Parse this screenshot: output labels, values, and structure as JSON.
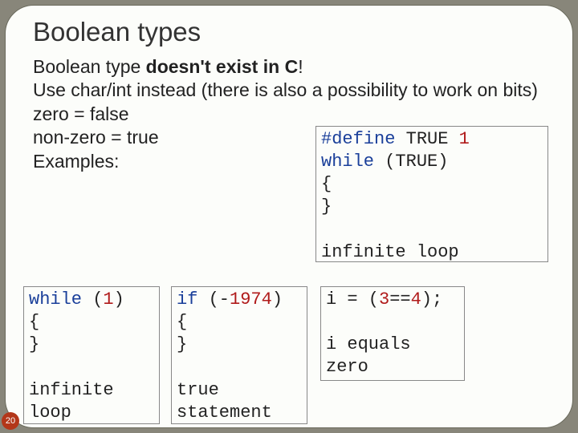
{
  "title": "Boolean types",
  "body": {
    "line1a": "Boolean type ",
    "line1b": "doesn't exist in C",
    "line1c": "!",
    "line2": "Use char/int instead (there is also a possibility to work on bits)",
    "line3": "zero = false",
    "line4": "non-zero = true",
    "line5": "Examples:"
  },
  "box1": {
    "l1a": "#define",
    "l1b": " TRUE ",
    "l1c": "1",
    "l2a": "while",
    "l2b": " (TRUE)",
    "l3": "{",
    "l4": "}",
    "l6": "infinite loop"
  },
  "box2": {
    "l1a": "while",
    "l1b": " (",
    "l1c": "1",
    "l1d": ")",
    "l2": "{",
    "l3": "}",
    "l5a": "infinite",
    "l5b": "loop"
  },
  "box3": {
    "l1a": "if",
    "l1b": " (-",
    "l1c": "1974",
    "l1d": ")",
    "l2": "{",
    "l3": "}",
    "l5a": "true",
    "l5b": "statement"
  },
  "box4": {
    "l1a": "i = (",
    "l1b": "3",
    "l1c": "==",
    "l1d": "4",
    "l1e": ");",
    "l3a": "i equals",
    "l3b": "zero"
  },
  "pagenum": "20"
}
